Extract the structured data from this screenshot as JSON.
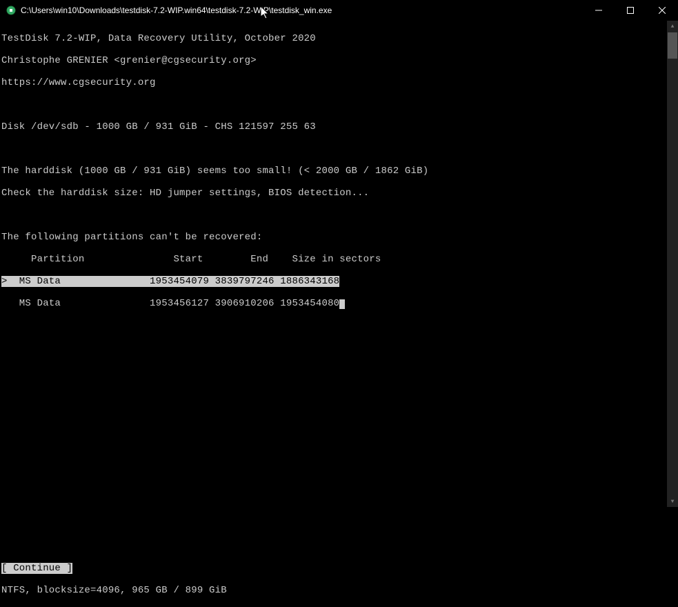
{
  "window": {
    "title": "C:\\Users\\win10\\Downloads\\testdisk-7.2-WIP.win64\\testdisk-7.2-WIP\\testdisk_win.exe"
  },
  "app": {
    "header1": "TestDisk 7.2-WIP, Data Recovery Utility, October 2020",
    "header2": "Christophe GRENIER <grenier@cgsecurity.org>",
    "header3": "https://www.cgsecurity.org"
  },
  "disk_info": "Disk /dev/sdb - 1000 GB / 931 GiB - CHS 121597 255 63",
  "warning1": "The harddisk (1000 GB / 931 GiB) seems too small! (< 2000 GB / 1862 GiB)",
  "warning2": "Check the harddisk size: HD jumper settings, BIOS detection...",
  "partitions_msg": "The following partitions can't be recovered:",
  "table": {
    "header": "     Partition               Start        End    Size in sectors",
    "rows": [
      ">  MS Data               1953454079 3839797246 1886343168",
      "   MS Data               1953456127 3906910206 1953454080"
    ]
  },
  "continue_label": "[ Continue ]",
  "footer": "NTFS, blocksize=4096, 965 GB / 899 GiB"
}
